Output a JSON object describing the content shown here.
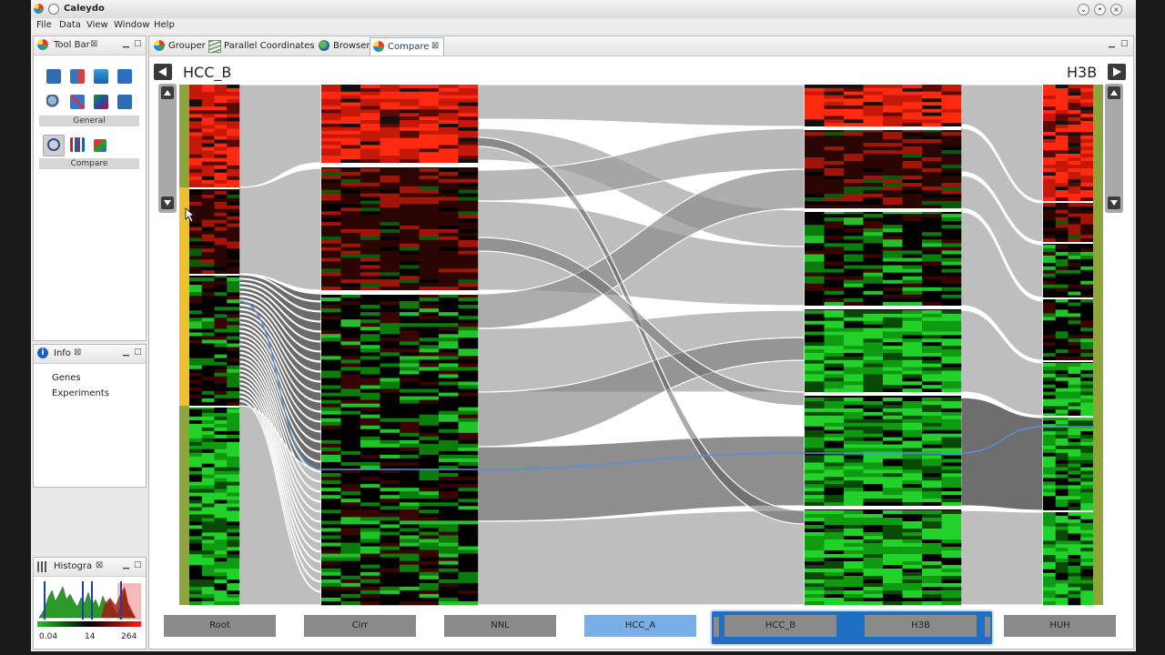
{
  "window": {
    "title": "Caleydo"
  },
  "menu": [
    "File",
    "Data",
    "View",
    "Window",
    "Help"
  ],
  "toolbar_panel": {
    "tab": "Tool Bar",
    "groups": [
      {
        "label": "General",
        "icons": [
          "save-icon",
          "swap-icon",
          "refresh-icon",
          "camera-icon",
          "zoom-icon",
          "clear-icon",
          "color-icon",
          "save-as-icon"
        ]
      },
      {
        "label": "Compare",
        "icons": [
          "search-icon",
          "columns-icon",
          "cluster-icon"
        ]
      }
    ]
  },
  "info_panel": {
    "tab": "Info",
    "items": [
      "Genes",
      "Experiments"
    ]
  },
  "histogram_panel": {
    "tab": "Histogra",
    "min": "0.04",
    "mid": "14",
    "max": "264"
  },
  "view_tabs": [
    {
      "label": "Grouper",
      "icon": "grouper-icon"
    },
    {
      "label": "Parallel Coordinates",
      "icon": "parallel-coordinates-icon"
    },
    {
      "label": "Browser",
      "icon": "globe-icon"
    },
    {
      "label": "Compare",
      "icon": "compare-icon",
      "active": true
    }
  ],
  "compare": {
    "left_name": "HCC_B",
    "right_name": "H3B",
    "buttons": [
      {
        "label": "Root",
        "state": "normal"
      },
      {
        "label": "Cirr",
        "state": "normal"
      },
      {
        "label": "NNL",
        "state": "normal"
      },
      {
        "label": "HCC_A",
        "state": "highlight"
      },
      {
        "label": "HCC_B",
        "state": "selected"
      },
      {
        "label": "H3B",
        "state": "selected"
      },
      {
        "label": "HUH",
        "state": "normal"
      }
    ]
  },
  "colors": {
    "red": "#ff2a10",
    "green": "#22d22a",
    "black": "#000000",
    "ribbon": "#bebebe",
    "yellow": "#e9c22c",
    "olive": "#8fa43a",
    "selected_blue": "#1f6fc2",
    "highlight_blue": "#7aaee6"
  }
}
